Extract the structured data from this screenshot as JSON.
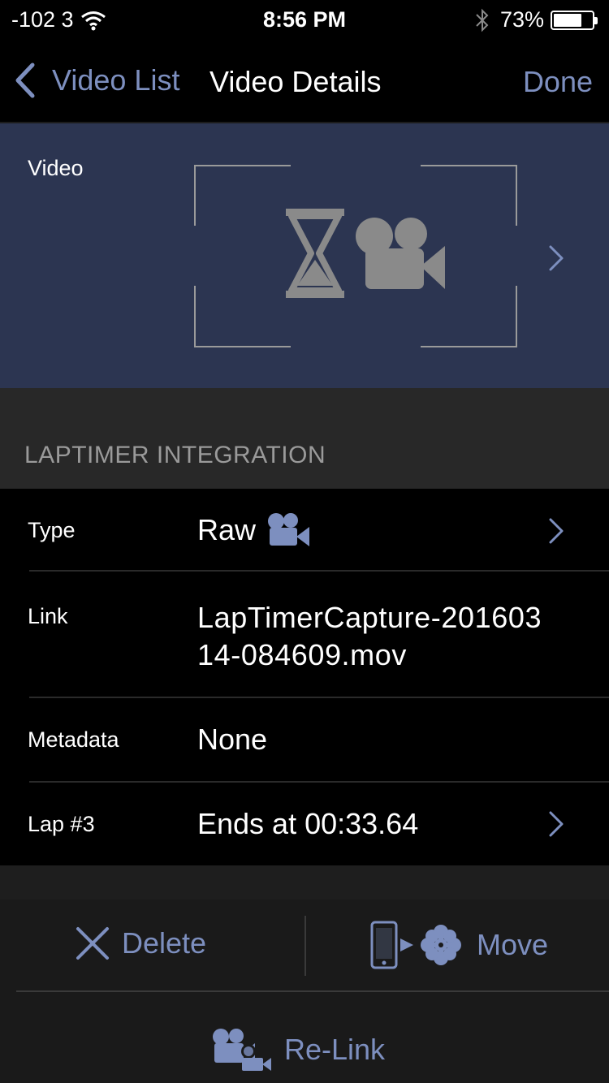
{
  "status_bar": {
    "carrier": "-102 3",
    "time": "8:56 PM",
    "battery_percent": "73%",
    "battery_level": 0.73
  },
  "nav": {
    "back_label": "Video List",
    "title": "Video Details",
    "done_label": "Done"
  },
  "video": {
    "label": "Video",
    "thumbnail_icons": [
      "hourglass-icon",
      "movie-camera-icon"
    ]
  },
  "section": {
    "header": "LAPTIMER INTEGRATION"
  },
  "rows": {
    "type": {
      "label": "Type",
      "value": "Raw"
    },
    "link": {
      "label": "Link",
      "value_line1": "LapTimerCapture-201603",
      "value_line2": "14-084609.mov"
    },
    "metadata": {
      "label": "Metadata",
      "value": "None"
    },
    "lap": {
      "label": "Lap #3",
      "value": "Ends at 00:33.64"
    }
  },
  "toolbar": {
    "delete_label": "Delete",
    "move_label": "Move",
    "relink_label": "Re-Link"
  },
  "colors": {
    "accent": "#7d8fbf",
    "video_bg": "#2c3551",
    "section_bg": "#282828",
    "icon_gray": "#8a8a8a"
  }
}
